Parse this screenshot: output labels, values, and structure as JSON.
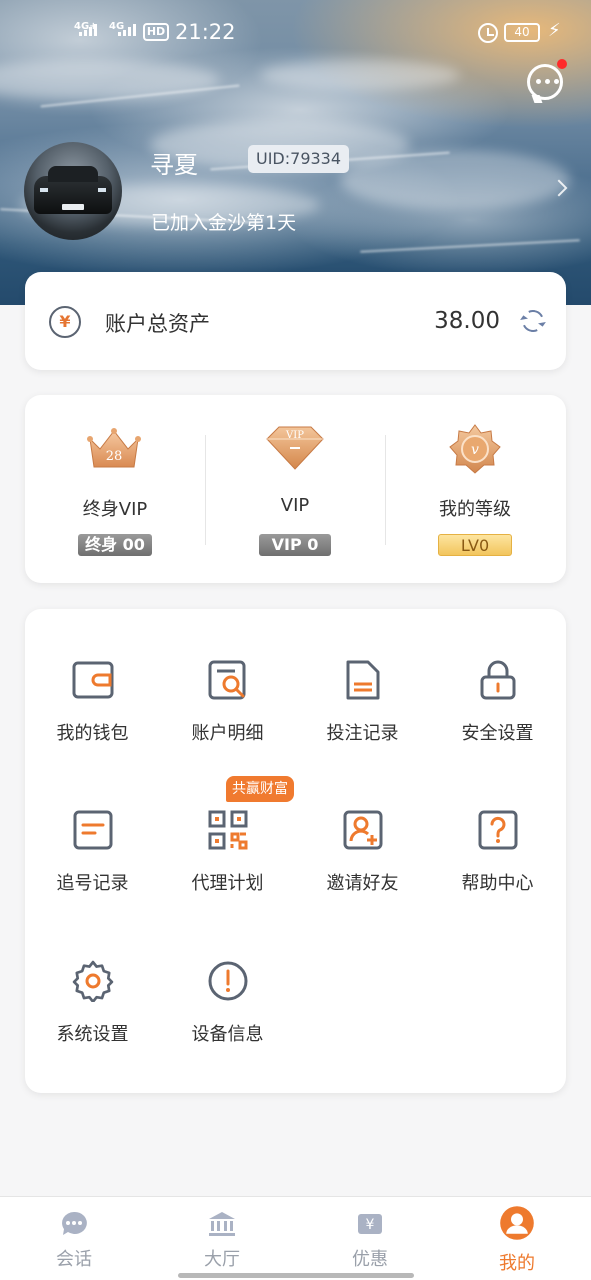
{
  "status_bar": {
    "network_1": "4G+",
    "network_2": "4G",
    "hd": "HD",
    "time": "21:22",
    "battery": "40"
  },
  "profile": {
    "username": "寻夏",
    "uid": "UID:79334",
    "joined": "已加入金沙第1天"
  },
  "asset": {
    "label": "账户总资产",
    "value": "38.00",
    "currency_symbol": "¥"
  },
  "vip": [
    {
      "label": "终身VIP",
      "badge": "终身 00",
      "crown_number": "28",
      "icon": "crown-icon"
    },
    {
      "label": "VIP",
      "badge": "VIP 0",
      "icon": "diamond-icon"
    },
    {
      "label": "我的等级",
      "badge": "LV0",
      "icon": "medal-icon"
    }
  ],
  "menu": {
    "items": [
      {
        "label": "我的钱包",
        "icon": "wallet-icon"
      },
      {
        "label": "账户明细",
        "icon": "account-details-icon"
      },
      {
        "label": "投注记录",
        "icon": "document-icon"
      },
      {
        "label": "安全设置",
        "icon": "lock-icon"
      },
      {
        "label": "追号记录",
        "icon": "list-icon"
      },
      {
        "label": "代理计划",
        "icon": "qr-code-icon"
      },
      {
        "label": "邀请好友",
        "icon": "add-user-icon"
      },
      {
        "label": "帮助中心",
        "icon": "question-icon"
      },
      {
        "label": "系统设置",
        "icon": "gear-icon"
      },
      {
        "label": "设备信息",
        "icon": "info-icon"
      }
    ],
    "promo_tag": "共赢财富"
  },
  "tabbar": {
    "tabs": [
      {
        "label": "会话",
        "icon": "chat-icon"
      },
      {
        "label": "大厅",
        "icon": "bank-icon"
      },
      {
        "label": "优惠",
        "icon": "coupon-icon"
      },
      {
        "label": "我的",
        "icon": "user-icon"
      }
    ],
    "active_index": 3
  },
  "colors": {
    "accent": "#ee7a2e",
    "icon_gray": "#5b6472",
    "tab_inactive": "#9aa0aa",
    "notification_dot": "#ff2a2a"
  }
}
